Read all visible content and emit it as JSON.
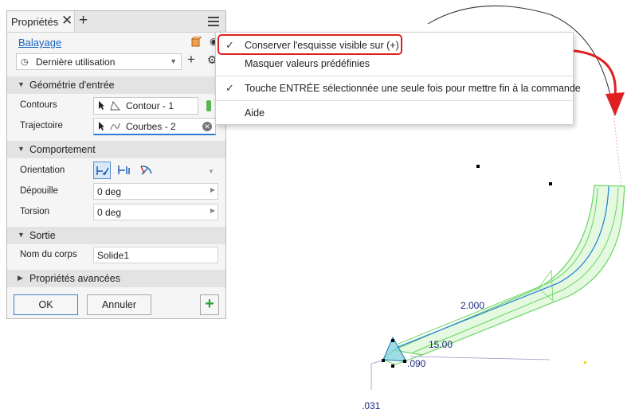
{
  "panel": {
    "tab_title": "Propriétés",
    "tab_close": "✕",
    "tab_add": "+",
    "command_link": "Balayage",
    "preset": "Dernière utilisation",
    "sections": {
      "input": "Géométrie d'entrée",
      "behavior": "Comportement",
      "output": "Sortie",
      "advanced": "Propriétés avancées"
    },
    "fields": {
      "profiles_label": "Contours",
      "profiles_value": "Contour - 1",
      "path_label": "Trajectoire",
      "path_value": "Courbes - 2",
      "orientation_label": "Orientation",
      "taper_label": "Dépouille",
      "taper_value": "0 deg",
      "twist_label": "Torsion",
      "twist_value": "0 deg",
      "body_label": "Nom du corps",
      "body_value": "Solide1"
    },
    "buttons": {
      "ok": "OK",
      "cancel": "Annuler",
      "add": "+"
    }
  },
  "context_menu": {
    "items": [
      {
        "label": "Conserver l'esquisse visible sur (+)",
        "checked": true
      },
      {
        "label": "Masquer valeurs prédéfinies",
        "checked": false
      },
      {
        "label": "Touche ENTRÉE sélectionnée une seule fois pour mettre fin à la commande",
        "checked": true
      },
      {
        "label": "Aide",
        "checked": false
      }
    ],
    "check_glyph": "✓"
  },
  "canvas": {
    "dimensions": {
      "d1": "2.000",
      "d2": "15.00",
      "d3": ".090",
      "d4": ".031"
    }
  },
  "colors": {
    "accent": "#1565c0",
    "highlight": "#e02020",
    "solid_preview": "#59d154"
  }
}
